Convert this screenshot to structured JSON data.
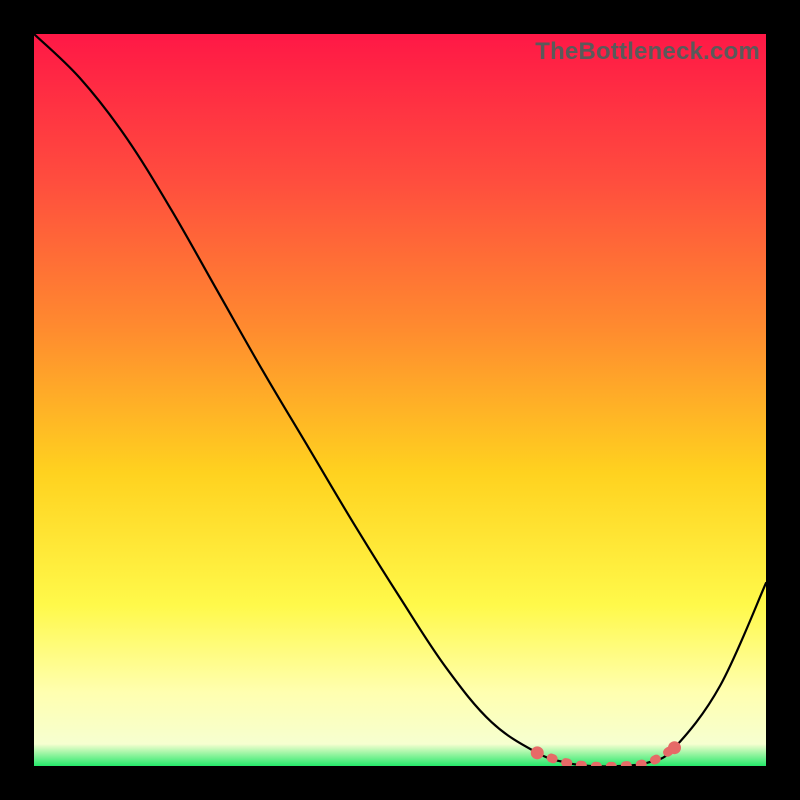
{
  "watermark": "TheBottleneck.com",
  "chart_data": {
    "type": "line",
    "title": "",
    "xlabel": "",
    "ylabel": "",
    "xlim": [
      0,
      100
    ],
    "ylim": [
      0,
      100
    ],
    "x": [
      0,
      6.25,
      12.5,
      18.75,
      25,
      31.25,
      37.5,
      43.75,
      50,
      56.25,
      62.5,
      68.75,
      72.5,
      76,
      80,
      84,
      87.5,
      93.75,
      100
    ],
    "values": [
      100,
      94,
      86,
      76,
      65,
      54,
      43.5,
      33,
      23,
      13.5,
      6,
      1.8,
      0.5,
      0,
      0,
      0.5,
      2.5,
      11,
      25
    ],
    "annotations": [],
    "legend": [],
    "grid": false,
    "background": {
      "type": "vertical-gradient",
      "stops": [
        {
          "pos": 0.0,
          "color": "#ff1846"
        },
        {
          "pos": 0.2,
          "color": "#ff4d3e"
        },
        {
          "pos": 0.4,
          "color": "#ff8a2f"
        },
        {
          "pos": 0.6,
          "color": "#ffd21f"
        },
        {
          "pos": 0.78,
          "color": "#fff94a"
        },
        {
          "pos": 0.9,
          "color": "#ffffb0"
        },
        {
          "pos": 0.97,
          "color": "#f6ffd0"
        },
        {
          "pos": 1.0,
          "color": "#25e96a"
        }
      ]
    },
    "highlight_segment": {
      "color": "#e66a67",
      "x_start": 68.75,
      "x_end": 87.5
    }
  }
}
